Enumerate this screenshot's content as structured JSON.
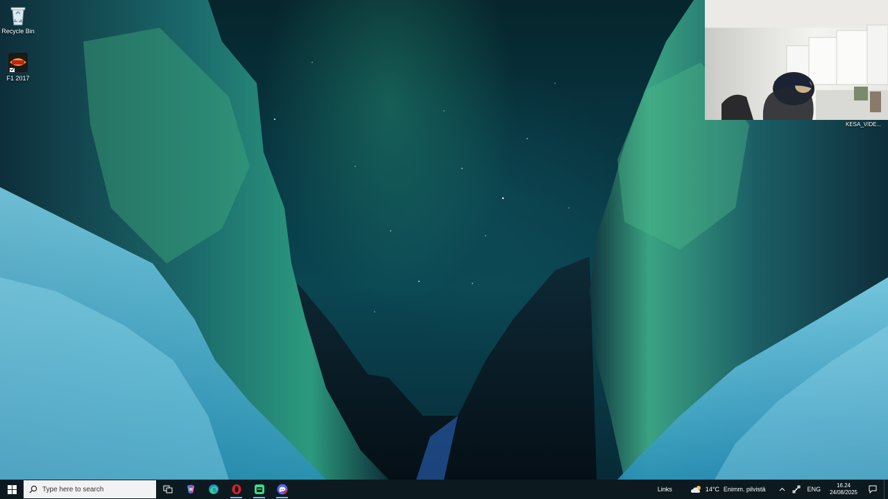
{
  "desktop": {
    "icons": [
      {
        "label": "Recycle Bin",
        "icon": "recycle-bin-icon"
      },
      {
        "label": "F1 2017",
        "icon": "f1-2017-game-icon"
      }
    ]
  },
  "webcam": {
    "label": "KESA_VIDE..."
  },
  "taskbar": {
    "search_placeholder": "Type here to search",
    "apps": [
      {
        "name": "task-view",
        "icon": "task-view-icon"
      },
      {
        "name": "copilot",
        "icon": "copilot-icon"
      },
      {
        "name": "edge",
        "icon": "edge-browser-icon"
      },
      {
        "name": "opera",
        "icon": "opera-browser-icon"
      },
      {
        "name": "android-app",
        "icon": "android-app-icon"
      },
      {
        "name": "discord",
        "icon": "discord-icon"
      }
    ],
    "tray": {
      "links_label": "Links",
      "weather_temp": "14°C",
      "weather_text": "Enimm. pilvistä",
      "language": "ENG",
      "time": "16.24",
      "date": "24/08/2025"
    }
  },
  "colors": {
    "taskbar_bg": "#0c1a1f",
    "active_indicator": "#76b9ed",
    "opera_red": "#e0202a",
    "discord_blurple": "#5865f2",
    "edge_blue": "#1f8fd6"
  }
}
